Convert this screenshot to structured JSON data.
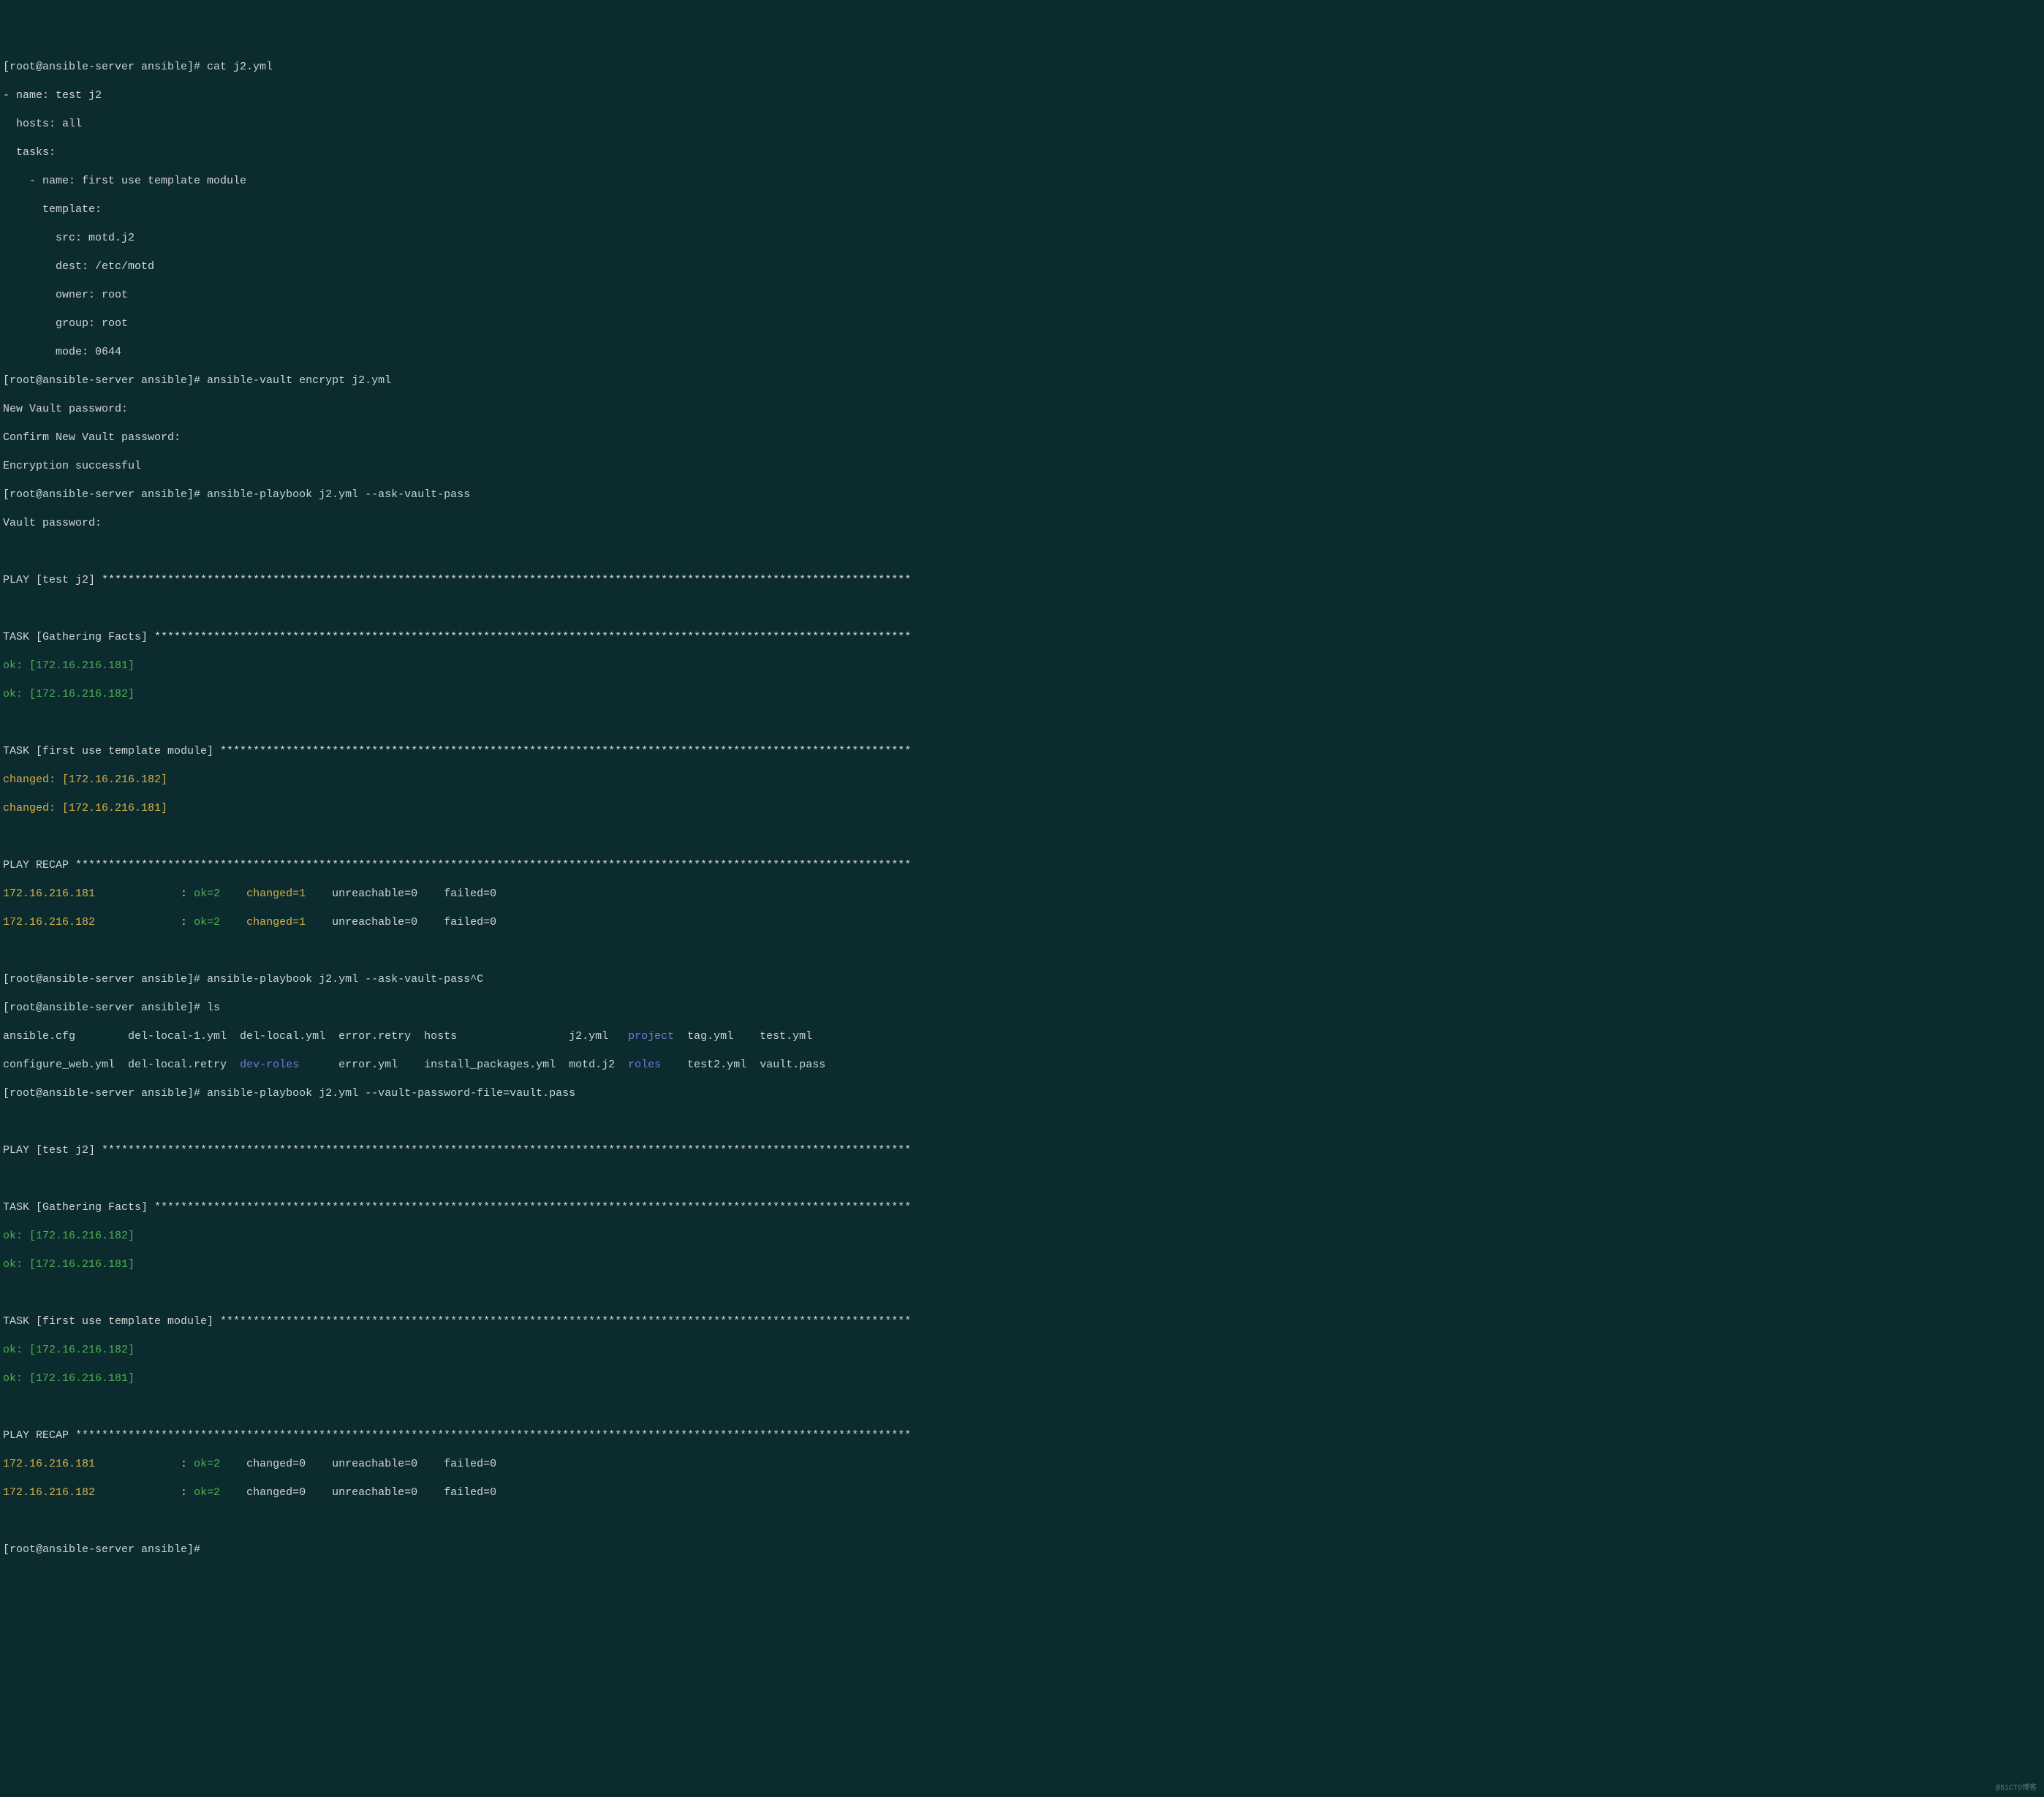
{
  "lines": [
    {
      "spans": [
        {
          "text": "[root@ansible-server ansible]# ",
          "cls": "prompt"
        },
        {
          "text": "cat j2.yml",
          "cls": "cmd"
        }
      ]
    },
    {
      "spans": [
        {
          "text": "- name: test j2",
          "cls": "white"
        }
      ]
    },
    {
      "spans": [
        {
          "text": "  hosts: all",
          "cls": "white"
        }
      ]
    },
    {
      "spans": [
        {
          "text": "  tasks:",
          "cls": "white"
        }
      ]
    },
    {
      "spans": [
        {
          "text": "    - name: first use template module",
          "cls": "white"
        }
      ]
    },
    {
      "spans": [
        {
          "text": "      template:",
          "cls": "white"
        }
      ]
    },
    {
      "spans": [
        {
          "text": "        src: motd.j2",
          "cls": "white"
        }
      ]
    },
    {
      "spans": [
        {
          "text": "        dest: /etc/motd",
          "cls": "white"
        }
      ]
    },
    {
      "spans": [
        {
          "text": "        owner: root",
          "cls": "white"
        }
      ]
    },
    {
      "spans": [
        {
          "text": "        group: root",
          "cls": "white"
        }
      ]
    },
    {
      "spans": [
        {
          "text": "        mode: 0644",
          "cls": "white"
        }
      ]
    },
    {
      "spans": [
        {
          "text": "[root@ansible-server ansible]# ",
          "cls": "prompt"
        },
        {
          "text": "ansible-vault encrypt j2.yml",
          "cls": "cmd"
        }
      ]
    },
    {
      "spans": [
        {
          "text": "New Vault password: ",
          "cls": "white"
        }
      ]
    },
    {
      "spans": [
        {
          "text": "Confirm New Vault password: ",
          "cls": "white"
        }
      ]
    },
    {
      "spans": [
        {
          "text": "Encryption successful",
          "cls": "white"
        }
      ]
    },
    {
      "spans": [
        {
          "text": "[root@ansible-server ansible]# ",
          "cls": "prompt"
        },
        {
          "text": "ansible-playbook j2.yml --ask-vault-pass",
          "cls": "cmd"
        }
      ]
    },
    {
      "spans": [
        {
          "text": "Vault password: ",
          "cls": "white"
        }
      ]
    },
    {
      "spans": [
        {
          "text": "",
          "cls": "white"
        }
      ]
    },
    {
      "spans": [
        {
          "text": "PLAY [test j2] ***************************************************************************************************************************",
          "cls": "white"
        }
      ]
    },
    {
      "spans": [
        {
          "text": "",
          "cls": "white"
        }
      ]
    },
    {
      "spans": [
        {
          "text": "TASK [Gathering Facts] *******************************************************************************************************************",
          "cls": "white"
        }
      ]
    },
    {
      "spans": [
        {
          "text": "ok: [172.16.216.181]",
          "cls": "green"
        }
      ]
    },
    {
      "spans": [
        {
          "text": "ok: [172.16.216.182]",
          "cls": "green"
        }
      ]
    },
    {
      "spans": [
        {
          "text": "",
          "cls": "white"
        }
      ]
    },
    {
      "spans": [
        {
          "text": "TASK [first use template module] *********************************************************************************************************",
          "cls": "white"
        }
      ]
    },
    {
      "spans": [
        {
          "text": "changed: [172.16.216.182]",
          "cls": "yellow"
        }
      ]
    },
    {
      "spans": [
        {
          "text": "changed: [172.16.216.181]",
          "cls": "yellow"
        }
      ]
    },
    {
      "spans": [
        {
          "text": "",
          "cls": "white"
        }
      ]
    },
    {
      "spans": [
        {
          "text": "PLAY RECAP *******************************************************************************************************************************",
          "cls": "white"
        }
      ]
    },
    {
      "spans": [
        {
          "text": "172.16.216.181",
          "cls": "yellow"
        },
        {
          "text": "             : ",
          "cls": "white"
        },
        {
          "text": "ok=2",
          "cls": "green"
        },
        {
          "text": "    ",
          "cls": "white"
        },
        {
          "text": "changed=1",
          "cls": "yellow"
        },
        {
          "text": "    unreachable=0    failed=0   ",
          "cls": "white"
        }
      ]
    },
    {
      "spans": [
        {
          "text": "172.16.216.182",
          "cls": "yellow"
        },
        {
          "text": "             : ",
          "cls": "white"
        },
        {
          "text": "ok=2",
          "cls": "green"
        },
        {
          "text": "    ",
          "cls": "white"
        },
        {
          "text": "changed=1",
          "cls": "yellow"
        },
        {
          "text": "    unreachable=0    failed=0   ",
          "cls": "white"
        }
      ]
    },
    {
      "spans": [
        {
          "text": "",
          "cls": "white"
        }
      ]
    },
    {
      "spans": [
        {
          "text": "[root@ansible-server ansible]# ",
          "cls": "prompt"
        },
        {
          "text": "ansible-playbook j2.yml --ask-vault-pass^C",
          "cls": "cmd"
        }
      ]
    },
    {
      "spans": [
        {
          "text": "[root@ansible-server ansible]# ",
          "cls": "prompt"
        },
        {
          "text": "ls",
          "cls": "cmd"
        }
      ]
    },
    {
      "spans": [
        {
          "text": "ansible.cfg        del-local-1.yml  del-local.yml  error.retry  hosts                 j2.yml   ",
          "cls": "gray"
        },
        {
          "text": "project",
          "cls": "blue"
        },
        {
          "text": "  tag.yml    test.yml",
          "cls": "gray"
        }
      ]
    },
    {
      "spans": [
        {
          "text": "configure_web.yml  del-local.retry  ",
          "cls": "gray"
        },
        {
          "text": "dev-roles",
          "cls": "blue"
        },
        {
          "text": "      error.yml    install_packages.yml  motd.j2  ",
          "cls": "gray"
        },
        {
          "text": "roles",
          "cls": "blue"
        },
        {
          "text": "    test2.yml  vault.pass",
          "cls": "gray"
        }
      ]
    },
    {
      "spans": [
        {
          "text": "[root@ansible-server ansible]# ",
          "cls": "prompt"
        },
        {
          "text": "ansible-playbook j2.yml --vault-password-file=vault.pass",
          "cls": "cmd"
        }
      ]
    },
    {
      "spans": [
        {
          "text": "",
          "cls": "white"
        }
      ]
    },
    {
      "spans": [
        {
          "text": "PLAY [test j2] ***************************************************************************************************************************",
          "cls": "white"
        }
      ]
    },
    {
      "spans": [
        {
          "text": "",
          "cls": "white"
        }
      ]
    },
    {
      "spans": [
        {
          "text": "TASK [Gathering Facts] *******************************************************************************************************************",
          "cls": "white"
        }
      ]
    },
    {
      "spans": [
        {
          "text": "ok: [172.16.216.182]",
          "cls": "green"
        }
      ]
    },
    {
      "spans": [
        {
          "text": "ok: [172.16.216.181]",
          "cls": "green"
        }
      ]
    },
    {
      "spans": [
        {
          "text": "",
          "cls": "white"
        }
      ]
    },
    {
      "spans": [
        {
          "text": "TASK [first use template module] *********************************************************************************************************",
          "cls": "white"
        }
      ]
    },
    {
      "spans": [
        {
          "text": "ok: [172.16.216.182]",
          "cls": "green"
        }
      ]
    },
    {
      "spans": [
        {
          "text": "ok: [172.16.216.181]",
          "cls": "green"
        }
      ]
    },
    {
      "spans": [
        {
          "text": "",
          "cls": "white"
        }
      ]
    },
    {
      "spans": [
        {
          "text": "PLAY RECAP *******************************************************************************************************************************",
          "cls": "white"
        }
      ]
    },
    {
      "spans": [
        {
          "text": "172.16.216.181",
          "cls": "yellow"
        },
        {
          "text": "             : ",
          "cls": "white"
        },
        {
          "text": "ok=2",
          "cls": "green"
        },
        {
          "text": "    changed=0    unreachable=0    failed=0   ",
          "cls": "white"
        }
      ]
    },
    {
      "spans": [
        {
          "text": "172.16.216.182",
          "cls": "yellow"
        },
        {
          "text": "             : ",
          "cls": "white"
        },
        {
          "text": "ok=2",
          "cls": "green"
        },
        {
          "text": "    changed=0    unreachable=0    failed=0   ",
          "cls": "white"
        }
      ]
    },
    {
      "spans": [
        {
          "text": "",
          "cls": "white"
        }
      ]
    },
    {
      "spans": [
        {
          "text": "[root@ansible-server ansible]# ",
          "cls": "prompt"
        }
      ]
    }
  ],
  "watermark": "@51CTO博客"
}
